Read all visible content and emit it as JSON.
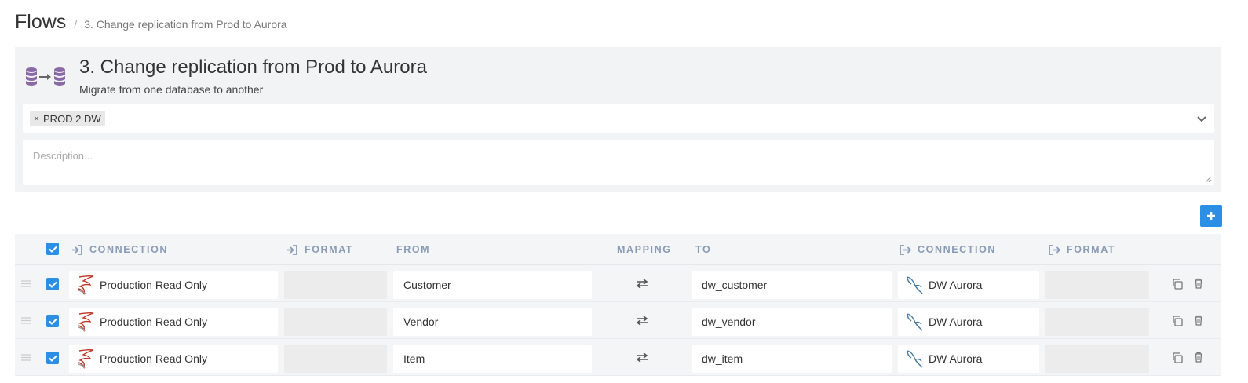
{
  "breadcrumb": {
    "root": "Flows",
    "separator": "/",
    "current": "3. Change replication from Prod to Aurora"
  },
  "flow": {
    "icon": "database-transfer-icon",
    "title": "3. Change replication from Prod to Aurora",
    "subtitle": "Migrate from one database to another",
    "tags": [
      {
        "remove": "×",
        "label": "PROD 2 DW"
      }
    ],
    "description_placeholder": "Description..."
  },
  "colors": {
    "accent": "#2b8fe5",
    "header_text": "#8a9bb5",
    "panel_bg": "#f2f3f5",
    "db_icon": "#8a6aa6"
  },
  "table": {
    "headers": {
      "source_connection": "CONNECTION",
      "source_format": "FORMAT",
      "from": "FROM",
      "mapping": "MAPPING",
      "to": "TO",
      "dest_connection": "CONNECTION",
      "dest_format": "FORMAT"
    },
    "rows": [
      {
        "checked": true,
        "source_connection": "Production Read Only",
        "source_icon": "sql-server-icon",
        "source_format": "",
        "from": "Customer",
        "mapping_icon": "arrows-exchange-icon",
        "to": "dw_customer",
        "dest_connection": "DW Aurora",
        "dest_icon": "mysql-dolphin-icon",
        "dest_format": ""
      },
      {
        "checked": true,
        "source_connection": "Production Read Only",
        "source_icon": "sql-server-icon",
        "source_format": "",
        "from": "Vendor",
        "mapping_icon": "arrows-exchange-icon",
        "to": "dw_vendor",
        "dest_connection": "DW Aurora",
        "dest_icon": "mysql-dolphin-icon",
        "dest_format": ""
      },
      {
        "checked": true,
        "source_connection": "Production Read Only",
        "source_icon": "sql-server-icon",
        "source_format": "",
        "from": "Item",
        "mapping_icon": "arrows-exchange-icon",
        "to": "dw_item",
        "dest_connection": "DW Aurora",
        "dest_icon": "mysql-dolphin-icon",
        "dest_format": ""
      }
    ]
  }
}
